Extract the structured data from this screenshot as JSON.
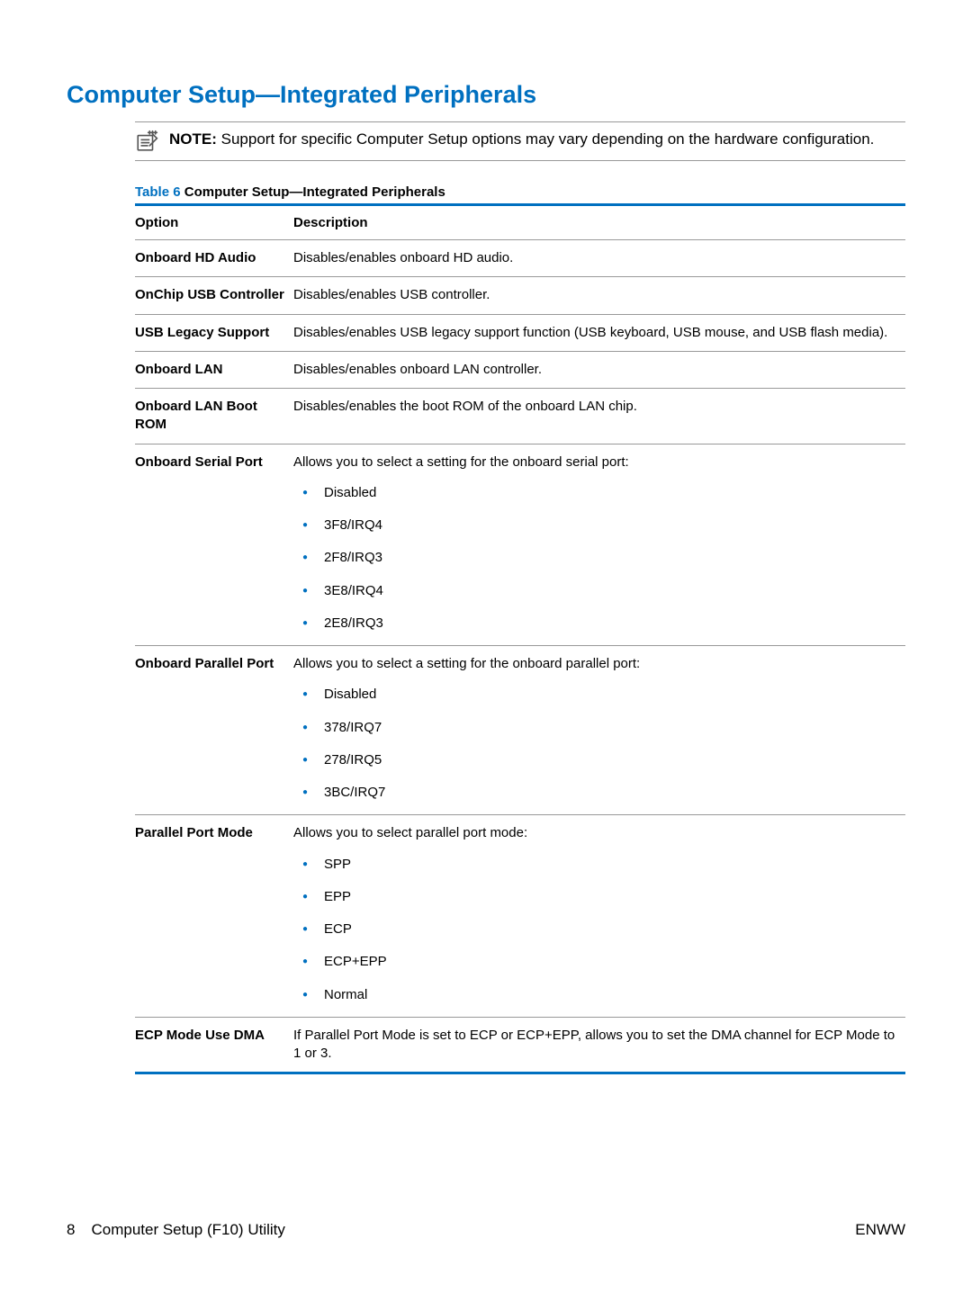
{
  "title": "Computer Setup—Integrated Peripherals",
  "note": {
    "label": "NOTE:",
    "text": "Support for specific Computer Setup options may vary depending on the hardware configuration."
  },
  "caption": {
    "prefix": "Table 6  ",
    "text": "Computer Setup—Integrated Peripherals"
  },
  "headers": {
    "option": "Option",
    "description": "Description"
  },
  "rows": [
    {
      "option": "Onboard HD Audio",
      "desc": "Disables/enables onboard HD audio."
    },
    {
      "option": "OnChip USB Controller",
      "desc": "Disables/enables USB controller."
    },
    {
      "option": "USB Legacy Support",
      "desc": "Disables/enables USB legacy support function (USB keyboard, USB mouse, and USB flash media)."
    },
    {
      "option": "Onboard LAN",
      "desc": "Disables/enables onboard LAN controller."
    },
    {
      "option": "Onboard LAN Boot ROM",
      "desc": "Disables/enables the boot ROM of the onboard LAN chip."
    },
    {
      "option": "Onboard Serial Port",
      "desc": "Allows you to select a setting for the onboard serial port:",
      "items": [
        "Disabled",
        "3F8/IRQ4",
        "2F8/IRQ3",
        "3E8/IRQ4",
        "2E8/IRQ3"
      ]
    },
    {
      "option": "Onboard Parallel Port",
      "desc": "Allows you to select a setting for the onboard parallel port:",
      "items": [
        "Disabled",
        "378/IRQ7",
        "278/IRQ5",
        "3BC/IRQ7"
      ]
    },
    {
      "option": "Parallel Port Mode",
      "desc": "Allows you to select parallel port mode:",
      "items": [
        "SPP",
        "EPP",
        "ECP",
        "ECP+EPP",
        "Normal"
      ]
    },
    {
      "option": "ECP Mode Use DMA",
      "desc": "If Parallel Port Mode is set to ECP or ECP+EPP, allows you to set the DMA channel for ECP Mode to 1 or 3."
    }
  ],
  "footer": {
    "page": "8",
    "section": "Computer Setup (F10) Utility",
    "right": "ENWW"
  }
}
